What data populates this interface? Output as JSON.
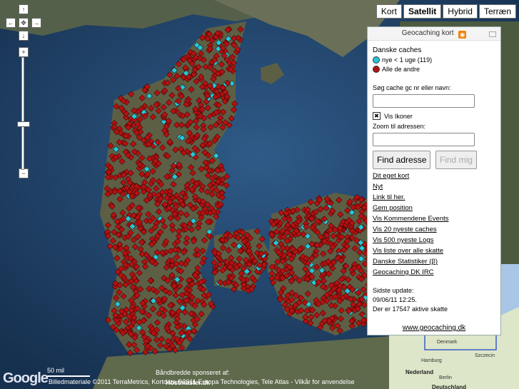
{
  "map_types": [
    {
      "label": "Kort",
      "active": false
    },
    {
      "label": "Satellit",
      "active": true
    },
    {
      "label": "Hybrid",
      "active": false
    },
    {
      "label": "Terræn",
      "active": false
    }
  ],
  "nav": {
    "up": "↑",
    "left": "←",
    "center": "✥",
    "right": "→",
    "down": "↓",
    "zoom_in": "+",
    "zoom_out": "−"
  },
  "panel": {
    "title": "Geocaching kort",
    "rss_icon": "rss-icon",
    "legend_heading": "Danske caches",
    "legend": [
      {
        "label": "nye < 1 uge (119)",
        "color": "#22c8d8"
      },
      {
        "label": "Alle de andre",
        "color": "#b31212"
      }
    ],
    "search_label": "Søg cache gc nr eller navn:",
    "show_icons_label": "Vis Ikoner",
    "show_icons_checked": "✖",
    "zoom_label": "Zoom til adressen:",
    "find_address": "Find adresse",
    "find_me": "Find mig",
    "links": [
      "Dit eget kort",
      "Nyt",
      "Link til her.",
      "Gem position",
      "Vis Kommendene Events",
      "Vis 20 nyeste caches",
      "Vis 500 nyeste Logs",
      "Vis liste over alle skatte",
      "Danske Statistiker (β)",
      "Geocaching DK IRC"
    ],
    "update_label": "Sidste update:",
    "update_time": "09/06/11 12:25.",
    "active_count": "Der er 17547 aktive skatte",
    "site": "www.geocaching.dk"
  },
  "footer": {
    "scale": "50 mil",
    "logo": "Google",
    "sponsor_line1": "Båndbredde sponseret af:",
    "sponsor_line2": "Hostmaster.dk",
    "copyright": "Billedmateriale ©2011 TerraMetrics, Kortdata ©2011 Europa Technologies, Tele Atlas -",
    "terms": "Vilkår for anvendelse"
  },
  "minimap": {
    "labels": [
      "Denmark",
      "Hamburg",
      "Szczecin",
      "Nederland",
      "Berlin",
      "Deutschland"
    ]
  }
}
